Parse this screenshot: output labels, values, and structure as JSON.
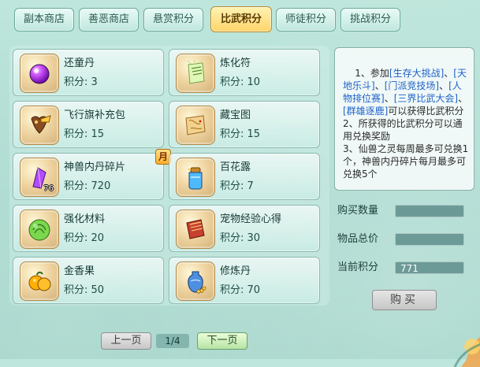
{
  "tabs": [
    {
      "label": "副本商店",
      "active": false
    },
    {
      "label": "善恶商店",
      "active": false
    },
    {
      "label": "悬赏积分",
      "active": false
    },
    {
      "label": "比武积分",
      "active": true
    },
    {
      "label": "师徒积分",
      "active": false
    },
    {
      "label": "挑战积分",
      "active": false
    }
  ],
  "items": [
    {
      "name": "还童丹",
      "points_text": "积分: 3",
      "icon": "purple-orb-icon"
    },
    {
      "name": "炼化符",
      "points_text": "积分: 10",
      "icon": "talisman-icon"
    },
    {
      "name": "飞行旗补充包",
      "points_text": "积分: 15",
      "icon": "flag-pack-icon"
    },
    {
      "name": "藏宝图",
      "points_text": "积分: 15",
      "icon": "treasure-map-icon"
    },
    {
      "name": "神兽内丹碎片",
      "points_text": "积分: 720",
      "icon": "crystal-shard-icon",
      "badge": "月",
      "count": "76"
    },
    {
      "name": "百花露",
      "points_text": "积分: 7",
      "icon": "potion-jar-icon"
    },
    {
      "name": "强化材料",
      "points_text": "积分: 20",
      "icon": "green-cabbage-icon"
    },
    {
      "name": "宠物经验心得",
      "points_text": "积分: 30",
      "icon": "red-book-icon"
    },
    {
      "name": "金香果",
      "points_text": "积分: 50",
      "icon": "orange-fruit-icon"
    },
    {
      "name": "修炼丹",
      "points_text": "积分: 70",
      "icon": "vase-coins-icon"
    }
  ],
  "info": {
    "lines": [
      {
        "text": "1、参加",
        "hl": false
      },
      {
        "text": "[生存大挑战]",
        "hl": true
      },
      {
        "text": "、",
        "hl": false
      },
      {
        "text": "[天地乐斗]",
        "hl": true
      },
      {
        "text": "、",
        "hl": false
      },
      {
        "text": "[门派竞技场]",
        "hl": true
      },
      {
        "text": "、",
        "hl": false
      },
      {
        "text": "[人物排位赛]",
        "hl": true
      },
      {
        "text": "、",
        "hl": false
      },
      {
        "text": "[三界比武大会]",
        "hl": true
      },
      {
        "text": "、",
        "hl": false
      },
      {
        "text": "[群雄逐鹿]",
        "hl": true
      },
      {
        "text": "可以获得比武积分\n2、所获得的比武积分可以通用兑换奖励\n3、仙兽之灵每周最多可兑换1个，神兽内丹碎片每月最多可兑换5个",
        "hl": false
      }
    ]
  },
  "fields": {
    "buy_qty_label": "购买数量",
    "buy_qty_value": "",
    "total_price_label": "物品总价",
    "total_price_value": "",
    "current_points_label": "当前积分",
    "current_points_value": "771"
  },
  "buttons": {
    "buy": "购买",
    "prev": "上一页",
    "next": "下一页"
  },
  "pager": {
    "page_text": "1/4"
  },
  "colors": {
    "active_tab": "#ffd46a",
    "info_highlight": "#1f61c9"
  }
}
